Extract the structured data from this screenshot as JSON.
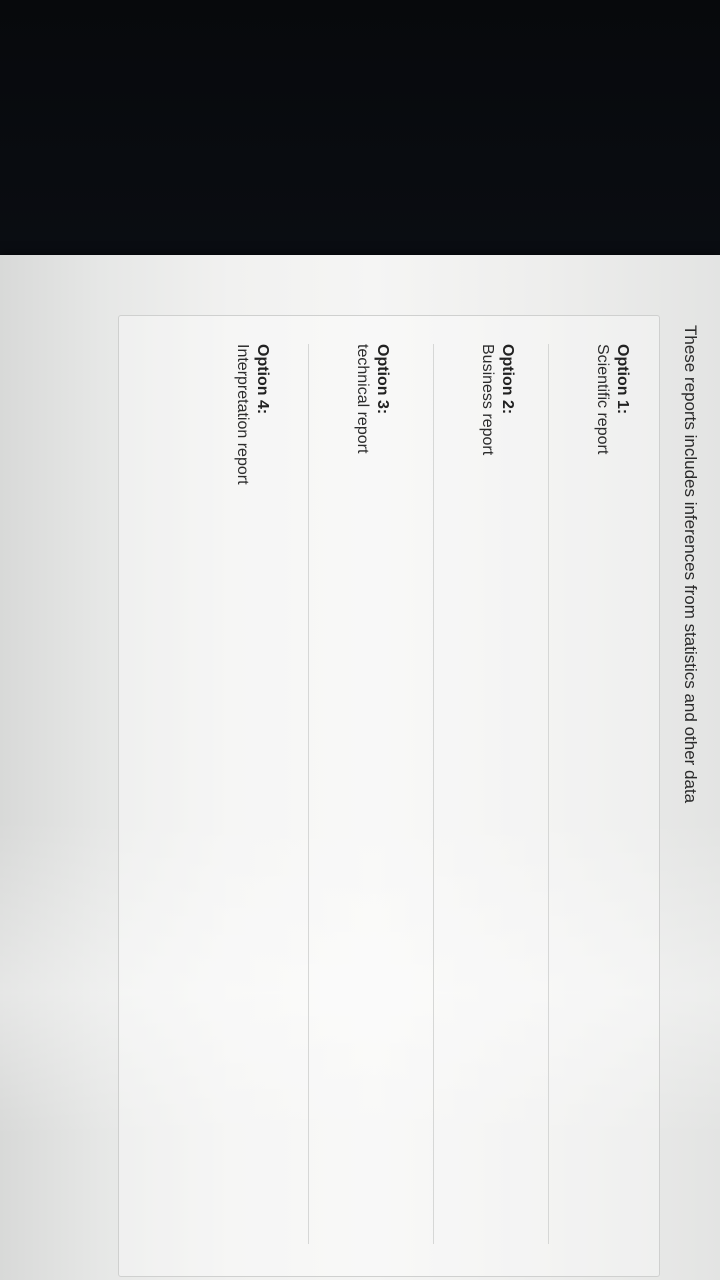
{
  "question": {
    "text": "These reports includes inferences from statistics and other data"
  },
  "options": [
    {
      "label": "Option 1:",
      "text": "Scientific report"
    },
    {
      "label": "Option 2:",
      "text": "Business report"
    },
    {
      "label": "Option 3:",
      "text": "technical report"
    },
    {
      "label": "Option 4:",
      "text": "Interpretation report"
    }
  ],
  "icons": {
    "cursor": "mouse-cursor-icon"
  }
}
